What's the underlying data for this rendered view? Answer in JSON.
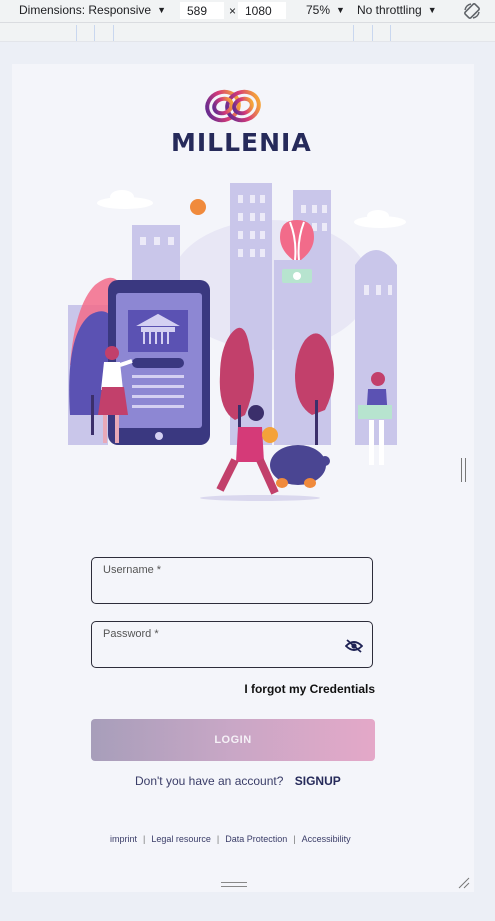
{
  "devtools": {
    "dimensions_label": "Dimensions: Responsive",
    "width_value": "589",
    "times": "×",
    "height_value": "1080",
    "zoom": "75%",
    "throttle": "No throttling"
  },
  "brand": {
    "name": "MILLENIA"
  },
  "form": {
    "username_label": "Username *",
    "password_label": "Password *",
    "forgot_link": "I forgot my Credentials",
    "login_button": "LOGIN",
    "no_account_text": "Don't you have an account?",
    "signup_link": "SIGNUP"
  },
  "footer": {
    "links": [
      "imprint",
      "Legal resource",
      "Data Protection",
      "Accessibility"
    ],
    "separator": "|"
  },
  "colors": {
    "brand_navy": "#262a5a",
    "accent_pink": "#d53a78",
    "accent_purple": "#5b3ea8"
  }
}
